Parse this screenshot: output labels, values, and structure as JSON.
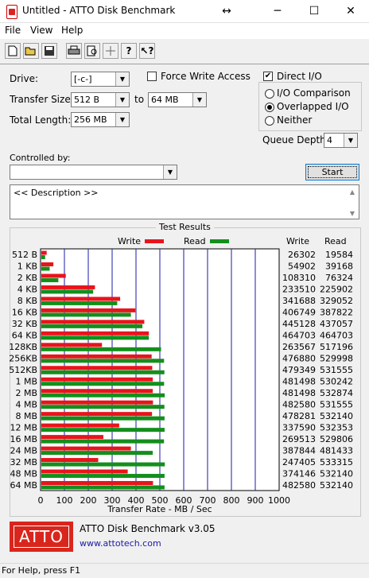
{
  "window": {
    "title": "Untitled - ATTO Disk Benchmark",
    "icon": "atto-app-icon",
    "controls": {
      "minimize": "─",
      "maximize": "☐",
      "close": "✕",
      "move": "↔"
    }
  },
  "menu": [
    "File",
    "View",
    "Help"
  ],
  "toolbar": {
    "buttons": [
      "new-icon",
      "open-icon",
      "save-icon",
      "print-icon",
      "print-preview-icon",
      "move-icon",
      "help-icon",
      "context-help-icon"
    ]
  },
  "settings": {
    "drive_label": "Drive:",
    "drive_value": "[-c-]",
    "transfer_size_label": "Transfer Size:",
    "transfer_from": "512 B",
    "to_label": "to",
    "transfer_to": "64 MB",
    "total_length_label": "Total Length:",
    "total_length": "256 MB",
    "force_write_label": "Force Write Access",
    "force_write_checked": false,
    "direct_io_label": "Direct I/O",
    "direct_io_checked": true,
    "io_options": [
      {
        "label": "I/O Comparison",
        "selected": false
      },
      {
        "label": "Overlapped I/O",
        "selected": true
      },
      {
        "label": "Neither",
        "selected": false
      }
    ],
    "queue_depth_label": "Queue Depth:",
    "queue_depth": "4",
    "controlled_by_label": "Controlled by:",
    "controlled_by_value": "",
    "start_label": "Start",
    "description": "<< Description >>"
  },
  "results": {
    "title": "Test Results",
    "legend_write": "Write",
    "legend_read": "Read",
    "col_write": "Write",
    "col_read": "Read",
    "write_color": "#e8141c",
    "read_color": "#138f1c"
  },
  "chart_data": {
    "type": "bar",
    "orientation": "horizontal",
    "xlabel": "Transfer Rate - MB / Sec",
    "xlim": [
      0,
      1000
    ],
    "xticks": [
      0,
      100,
      200,
      300,
      400,
      500,
      600,
      700,
      800,
      900,
      1000
    ],
    "categories": [
      "512 B",
      "1 KB",
      "2 KB",
      "4 KB",
      "8 KB",
      "16 KB",
      "32 KB",
      "64 KB",
      "128KB",
      "256KB",
      "512KB",
      "1 MB",
      "2 MB",
      "4 MB",
      "8 MB",
      "12 MB",
      "16 MB",
      "24 MB",
      "32 MB",
      "48 MB",
      "64 MB"
    ],
    "series": [
      {
        "name": "Write",
        "values_kb": [
          26302,
          54902,
          108310,
          233510,
          341688,
          406749,
          445128,
          464703,
          263567,
          476880,
          479349,
          481498,
          481498,
          482580,
          478281,
          337590,
          269513,
          387844,
          247405,
          374146,
          482580
        ]
      },
      {
        "name": "Read",
        "values_kb": [
          19584,
          39168,
          76324,
          225902,
          329052,
          387822,
          437057,
          464703,
          517196,
          529998,
          531555,
          530242,
          532874,
          531555,
          532140,
          532353,
          529806,
          481433,
          533315,
          532140,
          532140
        ]
      }
    ]
  },
  "footer": {
    "logo_text": "ATTO",
    "product": "ATTO Disk Benchmark v3.05",
    "link": "www.attotech.com"
  },
  "status": "For Help, press F1"
}
